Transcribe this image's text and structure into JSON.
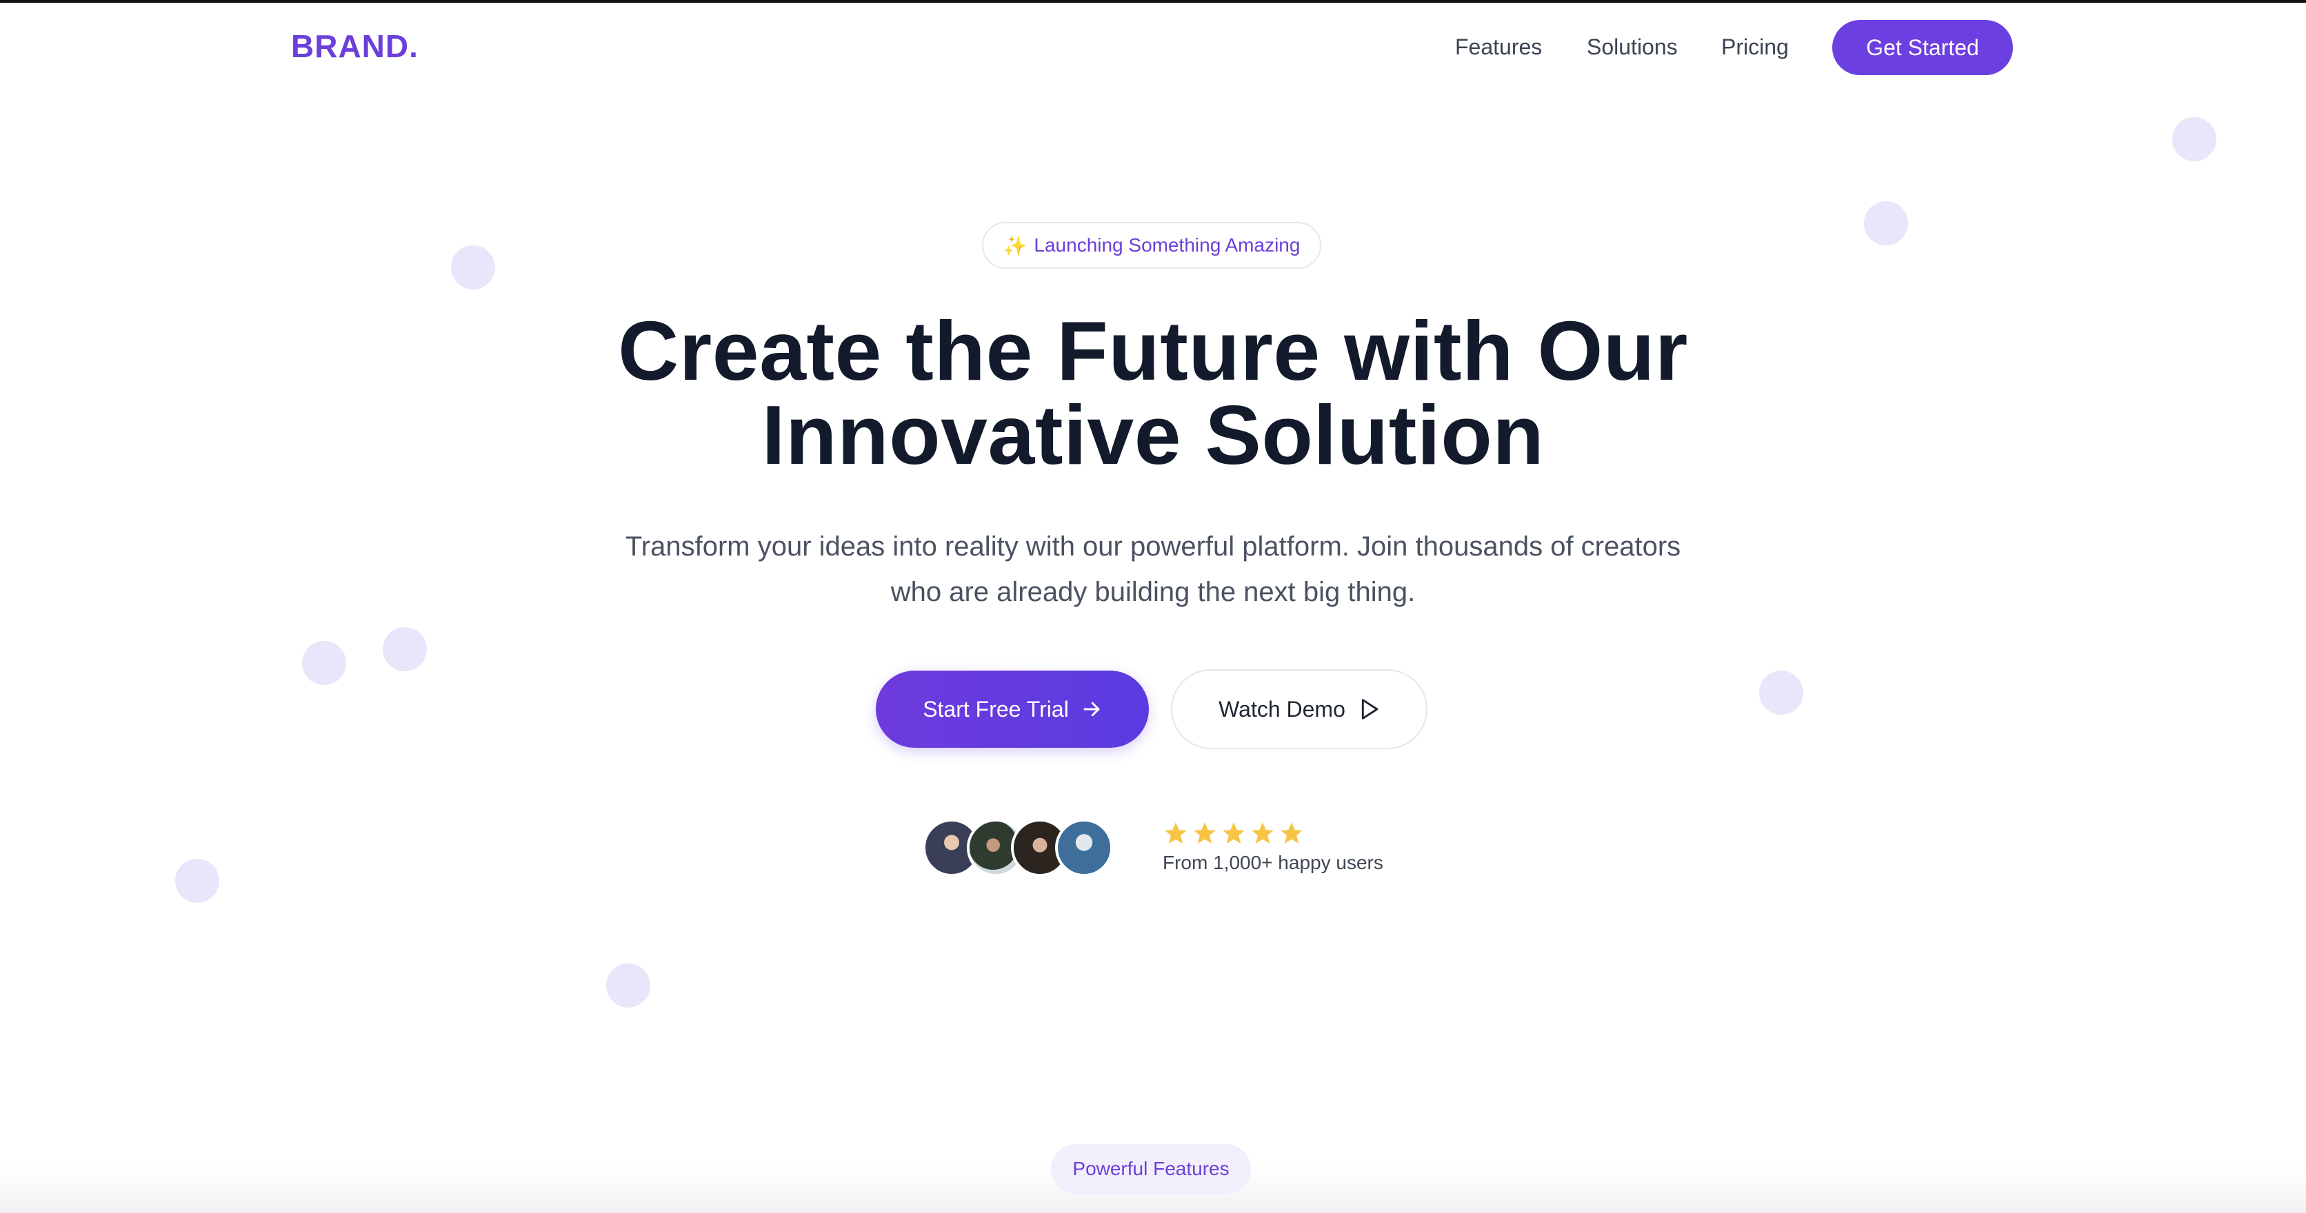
{
  "nav": {
    "logo": "BRAND.",
    "links": [
      "Features",
      "Solutions",
      "Pricing"
    ],
    "cta_label": "Get Started"
  },
  "hero": {
    "badge_icon": "sparkle-icon",
    "badge_text": "Launching Something Amazing",
    "headline_line1": "Create the Future with Our",
    "headline_line2": "Innovative Solution",
    "subtitle_line1": "Transform your ideas into reality with our powerful platform. Join thousands of creators",
    "subtitle_line2": "who are already building the next big thing.",
    "primary_button": "Start Free Trial",
    "secondary_button": "Watch Demo"
  },
  "social_proof": {
    "rating_stars": 5,
    "text": "From 1,000+ happy users"
  },
  "next_section": {
    "chip_label": "Powerful Features"
  },
  "colors": {
    "brand": "#6b3fd9",
    "heading": "#121a2b",
    "body_text": "#4b5261",
    "dot": "#e8e6fb",
    "star": "#f6c544"
  }
}
